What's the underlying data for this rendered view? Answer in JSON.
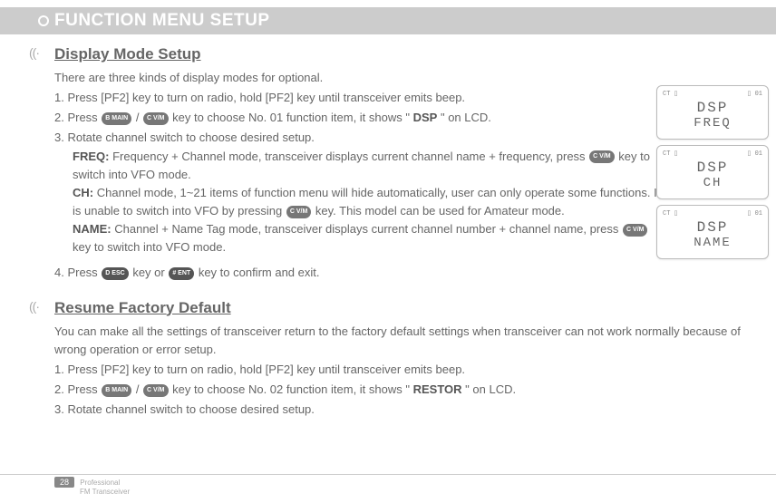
{
  "header": {
    "title": "FUNCTION MENU SETUP"
  },
  "section1": {
    "title": "Display Mode Setup",
    "intro": "There are three kinds of display modes for optional.",
    "step1": "1. Press [PF2] key to turn on radio, hold [PF2] key until transceiver emits beep.",
    "step2a": "2. Press ",
    "step2b": " / ",
    "step2c": " key to choose No. 01 function item, it shows \"",
    "step2_bold": "DSP",
    "step2d": "\" on LCD.",
    "step3": "3. Rotate channel switch to choose desired setup.",
    "freq_label": "FREQ:",
    "freq_text1": " Frequency + Channel mode, transceiver displays current channel name + frequency, press ",
    "freq_text2": " key to switch into VFO mode.",
    "ch_label": "CH:",
    "ch_text1": " Channel mode, 1~21 items of function menu will hide automatically, user can only operate some functions. It is unable to switch into VFO by pressing ",
    "ch_text2": " key. This model can be used for Amateur mode.",
    "name_label": "NAME:",
    "name_text1": " Channel + Name Tag mode, transceiver displays current channel number + channel name, press ",
    "name_text2": " key to switch into VFO mode.",
    "step4a": "4. Press ",
    "step4b": " key or ",
    "step4c": " key to confirm and exit."
  },
  "section2": {
    "title": "Resume Factory Default",
    "p1": "You can make all the settings of transceiver return to the factory default settings when transceiver can not work normally because of wrong operation or error setup.",
    "step1": "1. Press [PF2] key to turn on radio, hold [PF2] key until transceiver emits beep.",
    "step2a": "2. Press ",
    "step2b": " / ",
    "step2c": " key to choose No. 02 function item, it shows \"",
    "step2_bold": "RESTOR",
    "step2d": "\" on LCD.",
    "step3": "3. Rotate channel switch to choose desired setup."
  },
  "buttons": {
    "bmain": "B MAIN",
    "cvm": "C V/M",
    "desc": "D ESC",
    "ent": "# ENT"
  },
  "lcd": [
    {
      "top_l": "CT ▯",
      "top_r": "▯ 01",
      "line1": "DSP",
      "line2": "FREQ"
    },
    {
      "top_l": "CT ▯",
      "top_r": "▯ 01",
      "line1": "DSP",
      "line2": "CH"
    },
    {
      "top_l": "CT ▯",
      "top_r": "▯ 01",
      "line1": "DSP",
      "line2": "NAME"
    }
  ],
  "footer": {
    "page": "28",
    "line1": "Professional",
    "line2": "FM Transceiver"
  }
}
